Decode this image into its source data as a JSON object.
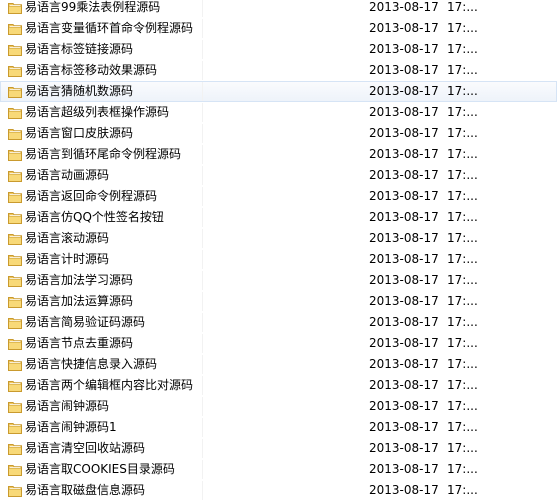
{
  "file_list": {
    "rows": [
      {
        "name": "易语言99乘法表例程源码",
        "date": "2013-08-17",
        "time": "17:..."
      },
      {
        "name": "易语言变量循环首命令例程源码",
        "date": "2013-08-17",
        "time": "17:..."
      },
      {
        "name": "易语言标签链接源码",
        "date": "2013-08-17",
        "time": "17:..."
      },
      {
        "name": "易语言标签移动效果源码",
        "date": "2013-08-17",
        "time": "17:..."
      },
      {
        "name": "易语言猜随机数源码",
        "date": "2013-08-17",
        "time": "17:..."
      },
      {
        "name": "易语言超级列表框操作源码",
        "date": "2013-08-17",
        "time": "17:..."
      },
      {
        "name": "易语言窗口皮肤源码",
        "date": "2013-08-17",
        "time": "17:..."
      },
      {
        "name": "易语言到循环尾命令例程源码",
        "date": "2013-08-17",
        "time": "17:..."
      },
      {
        "name": "易语言动画源码",
        "date": "2013-08-17",
        "time": "17:..."
      },
      {
        "name": "易语言返回命令例程源码",
        "date": "2013-08-17",
        "time": "17:..."
      },
      {
        "name": "易语言仿QQ个性签名按钮",
        "date": "2013-08-17",
        "time": "17:..."
      },
      {
        "name": "易语言滚动源码",
        "date": "2013-08-17",
        "time": "17:..."
      },
      {
        "name": "易语言计时源码",
        "date": "2013-08-17",
        "time": "17:..."
      },
      {
        "name": "易语言加法学习源码",
        "date": "2013-08-17",
        "time": "17:..."
      },
      {
        "name": "易语言加法运算源码",
        "date": "2013-08-17",
        "time": "17:..."
      },
      {
        "name": "易语言简易验证码源码",
        "date": "2013-08-17",
        "time": "17:..."
      },
      {
        "name": "易语言节点去重源码",
        "date": "2013-08-17",
        "time": "17:..."
      },
      {
        "name": "易语言快捷信息录入源码",
        "date": "2013-08-17",
        "time": "17:..."
      },
      {
        "name": "易语言两个编辑框内容比对源码",
        "date": "2013-08-17",
        "time": "17:..."
      },
      {
        "name": "易语言闹钟源码",
        "date": "2013-08-17",
        "time": "17:..."
      },
      {
        "name": "易语言闹钟源码1",
        "date": "2013-08-17",
        "time": "17:..."
      },
      {
        "name": "易语言清空回收站源码",
        "date": "2013-08-17",
        "time": "17:..."
      },
      {
        "name": "易语言取COOKIES目录源码",
        "date": "2013-08-17",
        "time": "17:..."
      },
      {
        "name": "易语言取磁盘信息源码",
        "date": "2013-08-17",
        "time": "17:..."
      }
    ],
    "hovered_row": 4
  },
  "icons": {
    "folder": "folder-icon"
  },
  "colors": {
    "folder_body": "#f0c75e",
    "folder_front": "#f8d978",
    "folder_edge": "#c99a2e",
    "hover_border": "#d6e4f5",
    "hover_fill": "#eef3fa"
  }
}
